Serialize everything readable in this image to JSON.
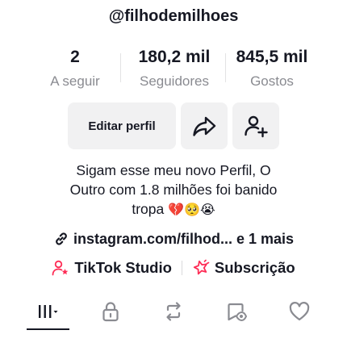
{
  "profile": {
    "username": "@filhodemilhoes"
  },
  "stats": {
    "following": {
      "value": "2",
      "label": "A seguir"
    },
    "followers": {
      "value": "180,2 mil",
      "label": "Seguidores"
    },
    "likes": {
      "value": "845,5 mil",
      "label": "Gostos"
    }
  },
  "actions": {
    "edit_label": "Editar perfil",
    "share_icon": "share-arrow-icon",
    "add_friend_icon": "add-user-icon"
  },
  "bio": {
    "line1": "Sigam esse meu novo Perfil, O",
    "line2": "Outro com 1.8 milhões foi banido",
    "line3": "tropa",
    "emojis": "💔🥺😭"
  },
  "link": {
    "text": "instagram.com/filhod... e 1 mais",
    "icon": "link-icon"
  },
  "tools": {
    "studio_label": "TikTok Studio",
    "studio_icon": "studio-person-icon",
    "studio_icon_color": "#fe2c55",
    "subscription_label": "Subscrição",
    "subscription_icon": "subscription-star-icon",
    "subscription_icon_color": "#fe2c55"
  },
  "tabs": {
    "items": [
      {
        "name": "videos-grid-icon",
        "active": true
      },
      {
        "name": "private-lock-icon",
        "active": false
      },
      {
        "name": "reposts-icon",
        "active": false
      },
      {
        "name": "favorites-icon",
        "active": false
      },
      {
        "name": "liked-heart-icon",
        "active": false
      }
    ]
  }
}
